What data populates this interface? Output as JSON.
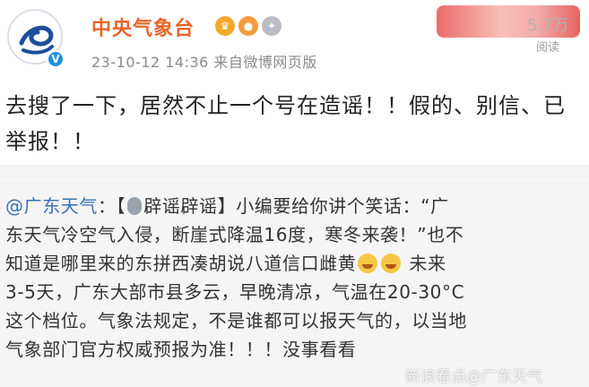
{
  "post": {
    "author": "中央气象台",
    "meta": "23-10-12 14:36 来自微博网页版",
    "read_count": "5.7万",
    "read_label": "阅读",
    "text": "去搜了一下，居然不止一个号在造谣！！假的、别信、已举报！！"
  },
  "repost": {
    "mention": "@广东天气",
    "lines": {
      "line1_rest": "：【",
      "line1_tag": "辟谣辟谣】小编要给你讲个笑话：“广",
      "line2": "东天气冷空气入侵，断崖式降温16度，寒冬来袭！”也不",
      "line3": "知道是哪里来的东拼西凑胡说八道信口雌黄",
      "line3_tail": "未来",
      "line4": "3-5天，广东大部市县多云，早晚清凉，气温在20-30°C",
      "line5": "这个档位。气象法规定，不是谁都可以报天气的，以当地",
      "line6": "气象部门官方权威预报为准！！！没事看看"
    }
  },
  "watermark": "新浪看点@广东天气",
  "colors": {
    "author": "#e8642a",
    "mention": "#3a6fb5",
    "verified": "#1f8fe0"
  },
  "icons": {
    "avatar": "cma-logo-icon",
    "verified": "verified-v-icon",
    "badges": [
      "crown-badge-icon",
      "fish-badge-icon",
      "medal-badge-icon"
    ],
    "emoji": [
      "microphone-emoji-icon",
      "laugh-cry-emoji-icon"
    ]
  }
}
